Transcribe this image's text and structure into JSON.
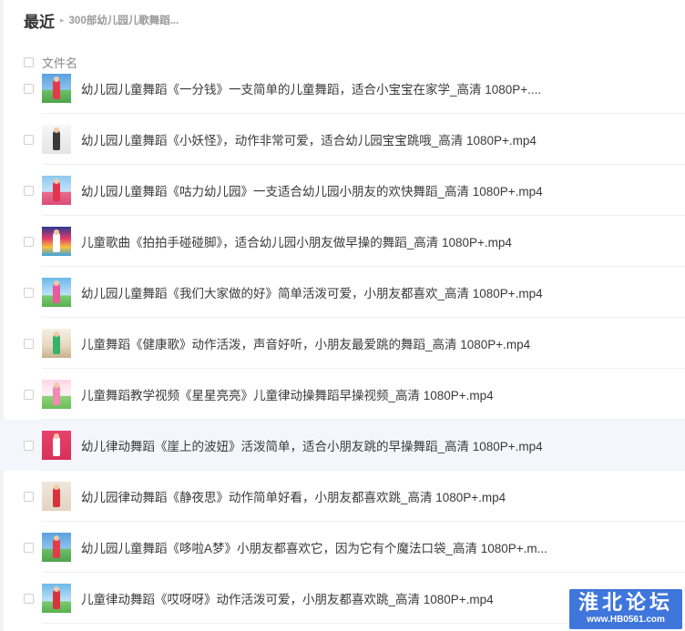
{
  "breadcrumb": {
    "root": "最近",
    "separator": "▸",
    "current": "300部幼儿园儿歌舞蹈..."
  },
  "list_header": {
    "column_label": "文件名"
  },
  "files": [
    {
      "name": "幼儿园儿童舞蹈《一分钱》一支简单的儿童舞蹈，适合小宝宝在家学_高清 1080P+....",
      "thumb": "t-blue",
      "fig": "#e23b4c"
    },
    {
      "name": "幼儿园儿童舞蹈《小妖怪》，动作非常可爱，适合幼儿园宝宝跳哦_高清 1080P+.mp4",
      "thumb": "t-white",
      "fig": "#3a3a3a"
    },
    {
      "name": "幼儿园儿童舞蹈《咕力幼儿园》一支适合幼儿园小朋友的欢快舞蹈_高清 1080P+.mp4",
      "thumb": "t-pink",
      "fig": "#e2334f"
    },
    {
      "name": "儿童歌曲《拍拍手碰碰脚》，适合幼儿园小朋友做早操的舞蹈_高清 1080P+.mp4",
      "thumb": "t-stage",
      "fig": "#ffffff"
    },
    {
      "name": "幼儿园儿童舞蹈《我们大家做的好》简单活泼可爱，小朋友都喜欢_高清 1080P+.mp4",
      "thumb": "t-sky",
      "fig": "#e85a9c"
    },
    {
      "name": "儿童舞蹈《健康歌》动作活泼，声音好听，小朋友最爱跳的舞蹈_高清 1080P+.mp4",
      "thumb": "t-room",
      "fig": "#35b36a"
    },
    {
      "name": "儿童舞蹈教学视频《星星亮亮》儿童律动操舞蹈早操视频_高清 1080P+.mp4",
      "thumb": "t-mint",
      "fig": "#f08bb2"
    },
    {
      "name": "幼儿律动舞蹈《崖上的波妞》活泼简单，适合小朋友跳的早操舞蹈_高清 1080P+.mp4",
      "thumb": "t-red",
      "fig": "#ffffff",
      "highlight": true
    },
    {
      "name": "幼儿园律动舞蹈《静夜思》动作简单好看，小朋友都喜欢跳_高清 1080P+.mp4",
      "thumb": "t-sand",
      "fig": "#d8343f"
    },
    {
      "name": "幼儿园儿童舞蹈《哆啦A梦》小朋友都喜欢它，因为它有个魔法口袋_高清 1080P+.m...",
      "thumb": "t-blue",
      "fig": "#e23b4c"
    },
    {
      "name": "儿童律动舞蹈《哎呀呀》动作活泼可爱，小朋友都喜欢跳_高清 1080P+.mp4",
      "thumb": "t-sky",
      "fig": "#d8343f"
    }
  ],
  "watermark": {
    "title": "淮北论坛",
    "url": "www.HB0561.com"
  }
}
